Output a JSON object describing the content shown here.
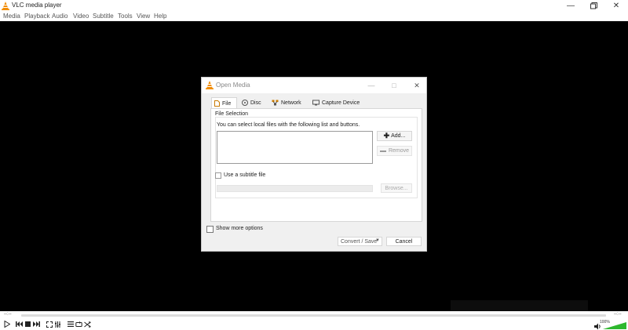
{
  "window": {
    "title": "VLC media player",
    "minimize_icon": "minimize-icon",
    "maximize_icon": "maximize-icon",
    "close_icon": "close-icon"
  },
  "menu": [
    "Media",
    "Playback",
    "Audio",
    "Video",
    "Subtitle",
    "Tools",
    "View",
    "Help"
  ],
  "dialog": {
    "title": "Open Media",
    "tabs": [
      {
        "label": "File",
        "icon": "file-icon"
      },
      {
        "label": "Disc",
        "icon": "disc-icon"
      },
      {
        "label": "Network",
        "icon": "network-icon"
      },
      {
        "label": "Capture Device",
        "icon": "capture-device-icon"
      }
    ],
    "file_selection_label": "File Selection",
    "file_description": "You can select local files with the following list and buttons.",
    "add_button": "Add...",
    "remove_button": "Remove",
    "subtitle_checkbox_label": "Use a subtitle file",
    "subtitle_checked": false,
    "browse_button": "Browse...",
    "show_more_label": "Show more options",
    "show_more_checked": false,
    "convert_button": "Convert / Save",
    "cancel_button": "Cancel"
  },
  "player": {
    "time_elapsed": "--:--",
    "time_total": "--:--",
    "volume_percent": "100%",
    "volume_level": 1.0,
    "accent": "#2eb82e"
  },
  "colors": {
    "vlc_orange": "#f28c00",
    "video_background": "#000000"
  }
}
